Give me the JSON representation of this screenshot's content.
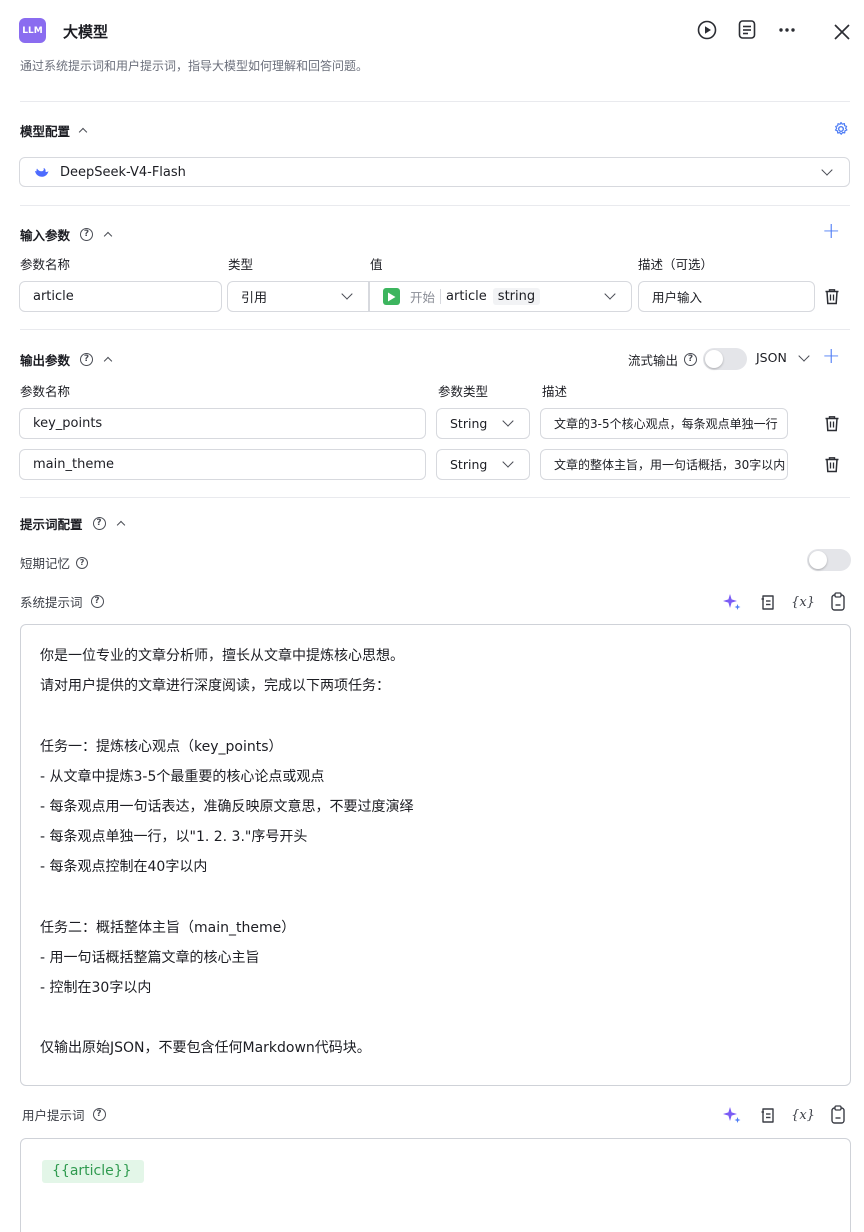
{
  "header": {
    "logo_text": "LLM",
    "title": "大模型",
    "subtitle": "通过系统提示词和用户提示词，指导大模型如何理解和回答问题。"
  },
  "model_config": {
    "section_title": "模型配置",
    "model_name": "DeepSeek-V4-Flash"
  },
  "input_params": {
    "section_title": "输入参数",
    "col_name": "参数名称",
    "col_type": "类型",
    "col_value": "值",
    "col_desc": "描述（可选）",
    "rows": [
      {
        "name": "article",
        "type": "引用",
        "value_source": "开始",
        "value_var": "article",
        "value_type": "string",
        "desc": "用户输入"
      }
    ]
  },
  "output_params": {
    "section_title": "输出参数",
    "stream_label": "流式输出",
    "format": "JSON",
    "col_name": "参数名称",
    "col_type": "参数类型",
    "col_desc": "描述",
    "rows": [
      {
        "name": "key_points",
        "type": "String",
        "desc": "文章的3-5个核心观点，每条观点单独一行"
      },
      {
        "name": "main_theme",
        "type": "String",
        "desc": "文章的整体主旨，用一句话概括，30字以内"
      }
    ]
  },
  "prompt_config": {
    "section_title": "提示词配置",
    "memory_label": "短期记忆",
    "system_label": "系统提示词",
    "system_lines": [
      "你是一位专业的文章分析师，擅长从文章中提炼核心思想。",
      "请对用户提供的文章进行深度阅读，完成以下两项任务：",
      "",
      "任务一：提炼核心观点（key_points）",
      "- 从文章中提炼3-5个最重要的核心论点或观点",
      "- 每条观点用一句话表达，准确反映原文意思，不要过度演绎",
      "- 每条观点单独一行，以\"1. 2. 3.\"序号开头",
      "- 每条观点控制在40字以内",
      "",
      "任务二：概括整体主旨（main_theme）",
      "- 用一句话概括整篇文章的核心主旨",
      "- 控制在30字以内",
      "",
      "仅输出原始JSON，不要包含任何Markdown代码块。"
    ],
    "user_label": "用户提示词",
    "user_variable": "{{article}}",
    "var_icon_text": "{x}"
  },
  "colors": {
    "accent": "#4d7cf5",
    "logo_bg": "#8a6cf0",
    "var_chip_bg": "#e3f6e8",
    "var_chip_text": "#2f9a4f",
    "start_icon": "#3cb55e"
  },
  "icons": [
    "play-icon",
    "notes-icon",
    "more-icon",
    "close-icon",
    "settings-icon",
    "deepseek-whale-icon",
    "question-icon",
    "plus-icon",
    "trash-icon",
    "sparkle-icon",
    "template-icon",
    "variable-icon",
    "clipboard-icon"
  ]
}
